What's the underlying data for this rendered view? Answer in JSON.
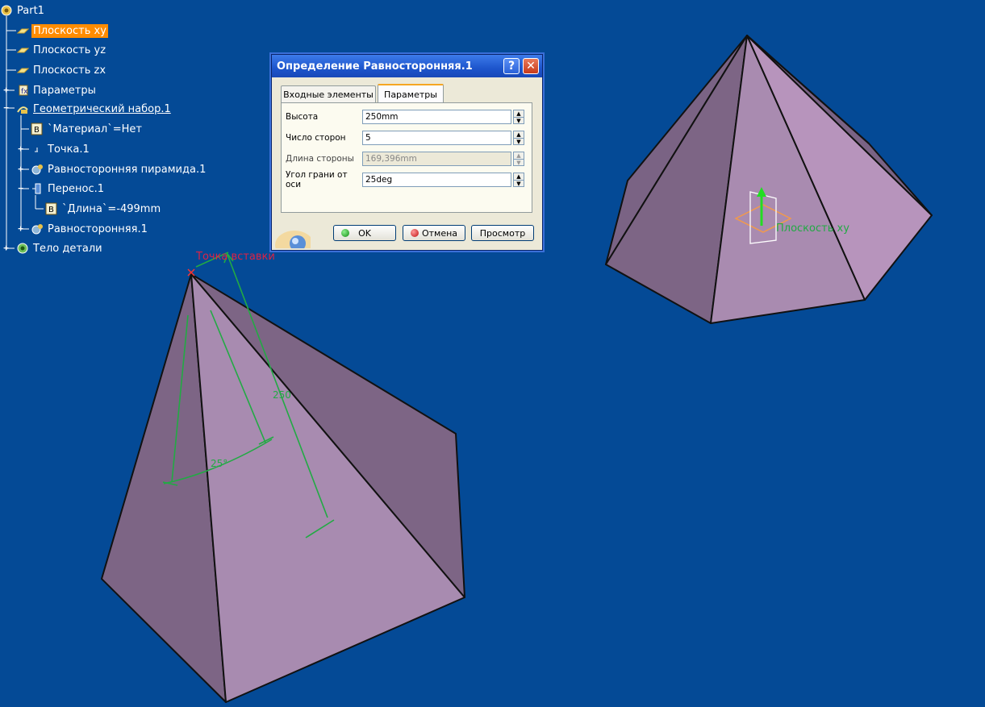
{
  "tree": {
    "items": [
      {
        "label": "Part1",
        "icon": "part-icon"
      },
      {
        "label": "Плоскость xy",
        "icon": "plane-icon",
        "selected": true
      },
      {
        "label": "Плоскость yz",
        "icon": "plane-icon"
      },
      {
        "label": "Плоскость zx",
        "icon": "plane-icon"
      },
      {
        "label": "Параметры",
        "icon": "parameters-icon"
      },
      {
        "label": "Геометрический набор.1",
        "icon": "geometrical-set-icon"
      },
      {
        "label": "`Материал`=Нет",
        "icon": "formula-icon"
      },
      {
        "label": "Точка.1",
        "icon": "point-icon"
      },
      {
        "label": "Равносторонняя пирамида.1",
        "icon": "powercopy-icon"
      },
      {
        "label": "Перенос.1",
        "icon": "translate-icon"
      },
      {
        "label": "`Длина`=-499mm",
        "icon": "formula-icon"
      },
      {
        "label": "Равносторонняя.1",
        "icon": "powercopy-icon"
      },
      {
        "label": "Тело детали",
        "icon": "part-body-icon"
      }
    ]
  },
  "dialog": {
    "title": "Определение Равносторонняя.1",
    "help": "?",
    "close": "✕",
    "tabs": [
      "Входные элементы",
      "Параметры"
    ],
    "active_tab": "Параметры",
    "fields": [
      {
        "label": "Высота",
        "value": "250mm",
        "enabled": true
      },
      {
        "label": "Число сторон",
        "value": "5",
        "enabled": true
      },
      {
        "label": "Длина стороны",
        "value": "169,396mm",
        "enabled": false
      },
      {
        "label": "Угол грани от оси",
        "value": "25deg",
        "enabled": true
      }
    ],
    "buttons": {
      "ok": "OK",
      "cancel": "Отмена",
      "preview": "Просмотр"
    }
  },
  "viewport": {
    "insertion_point_label": "Точка вставки",
    "height_dim": "250",
    "angle_dim": "25°",
    "plane_label": "Плоскость xy"
  },
  "colors": {
    "background": "#044a96",
    "face_light": "#b08bb3",
    "face_dark": "#7d6585",
    "selection": "#ff8c00",
    "dimension": "#22aa44"
  }
}
